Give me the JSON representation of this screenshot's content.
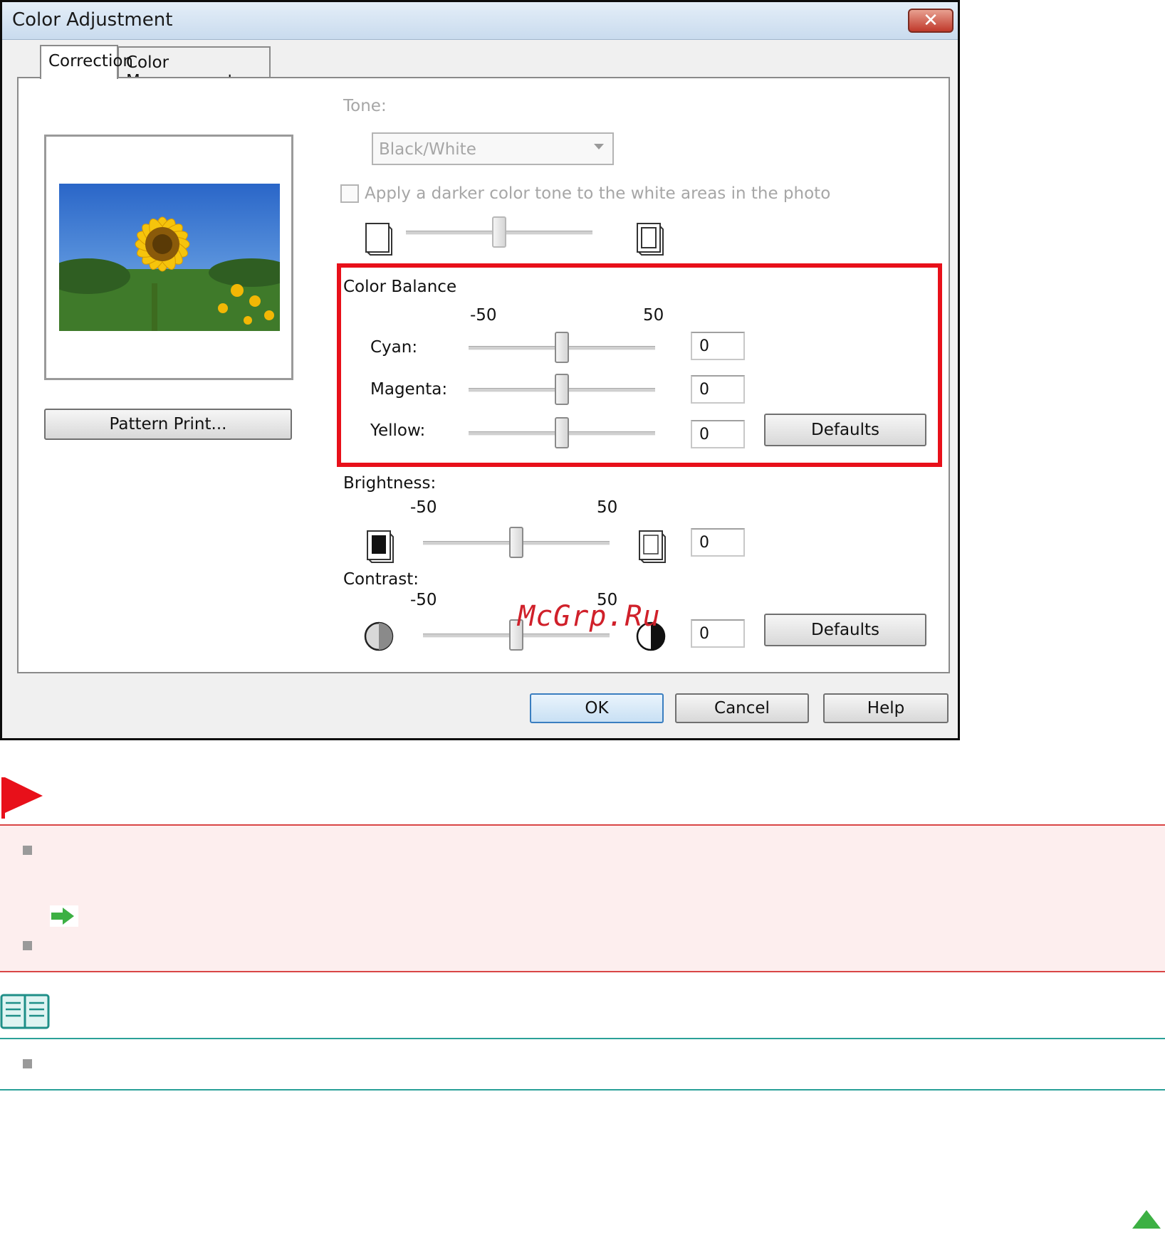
{
  "window": {
    "title": "Color Adjustment"
  },
  "tabs": [
    {
      "label": "Correction",
      "active": true
    },
    {
      "label": "Color Management",
      "active": false
    }
  ],
  "preview": {
    "pattern_print_label": "Pattern Print..."
  },
  "tone": {
    "label": "Tone:",
    "selected": "Black/White",
    "darker_checkbox_label": "Apply a darker color tone to the white areas in the photo",
    "darker_checked": false,
    "slider_level_percent": 50
  },
  "color_balance": {
    "label": "Color Balance",
    "min_label": "-50",
    "max_label": "50",
    "cyan": {
      "label": "Cyan:",
      "value": "0"
    },
    "magenta": {
      "label": "Magenta:",
      "value": "0"
    },
    "yellow": {
      "label": "Yellow:",
      "value": "0"
    },
    "defaults_label": "Defaults"
  },
  "brightness": {
    "label": "Brightness:",
    "min_label": "-50",
    "max_label": "50",
    "value": "0"
  },
  "contrast": {
    "label": "Contrast:",
    "min_label": "-50",
    "max_label": "50",
    "value": "0",
    "defaults_label": "Defaults"
  },
  "buttons": {
    "ok": "OK",
    "cancel": "Cancel",
    "help": "Help"
  },
  "watermark": "McGrp.Ru",
  "colors": {
    "highlight": "#e8101a",
    "important_bg": "#fdeeee",
    "important_border": "#d94545",
    "note_border": "#2aa098",
    "accent_green": "#3cb043"
  }
}
